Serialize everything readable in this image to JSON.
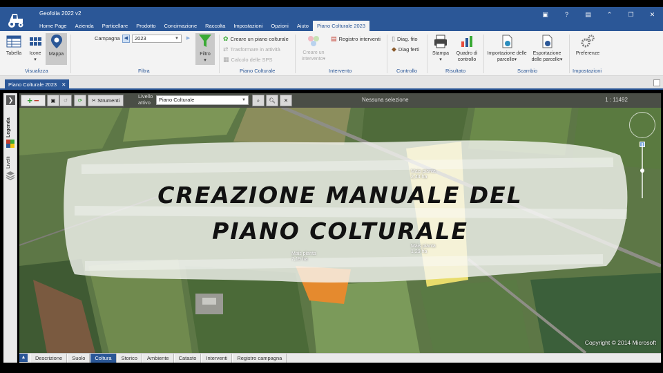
{
  "app": {
    "title": "Geofolia 2022 v2",
    "menu": [
      "Home Page",
      "Azienda",
      "Particellare",
      "Prodotto",
      "Concimazione",
      "Raccolta",
      "Impostazioni",
      "Opzioni",
      "Aiuto",
      "Piano Colturale 2023"
    ],
    "active_menu": "Piano Colturale 2023",
    "window_controls": [
      "▣",
      "?",
      "▤",
      "⌃",
      "❐",
      "✕"
    ]
  },
  "ribbon": {
    "visualizza": {
      "label": "Visualizza",
      "tabella": "Tabella",
      "icone": "Icone",
      "mappa": "Mappa"
    },
    "filtra": {
      "label": "Filtra",
      "campagna_label": "Campagna",
      "campagna_value": "2023",
      "filtro": "Filtro"
    },
    "piano": {
      "label": "Piano Colturale",
      "creare": "Creare un piano colturale",
      "trasformare": "Trasformare in attività",
      "calcolo": "Calcolo delle SPS"
    },
    "intervento": {
      "label": "Intervento",
      "creare": "Creare un intervento",
      "registro": "Registro interventi"
    },
    "controllo": {
      "label": "Controllo",
      "diag_fito": "Diag. fito",
      "diag_ferti": "Diag ferti"
    },
    "risultato": {
      "label": "Risultato",
      "stampa": "Stampa",
      "quadro": "Quadro di controllo"
    },
    "scambio": {
      "label": "Scambio",
      "importazione": "Importazione delle parcelle",
      "esportazione": "Esportazione delle parcelle"
    },
    "impostazioni": {
      "label": "Impostazioni",
      "preferenze": "Preferenze"
    }
  },
  "doc_tab": {
    "label": "Piano Colturale 2023",
    "close": "✕"
  },
  "left_rail": {
    "legenda": "Legenda",
    "livelli": "Livelli"
  },
  "map": {
    "toolbar": {
      "strumenti": "Strumenti",
      "livello_label_1": "Livello",
      "livello_label_2": "attivo",
      "livello_value": "Piano Colturale",
      "selection": "Nessuna selezione",
      "scale": "1 : 11492"
    },
    "headline_line1": "CREAZIONE MANUALE DEL",
    "headline_line2": "PIANO COLTURALE",
    "parcels": [
      {
        "name": "Mais pianta",
        "area": "2,44 ha"
      },
      {
        "name": "Mais pianta",
        "area": "1,29 ha"
      },
      {
        "name": "Mais pianta",
        "area": "7,19 ha"
      }
    ],
    "copyright": "Copyright © 2014 Microsoft"
  },
  "bottom_tabs": [
    "Descrizione",
    "Suolo",
    "Coltura",
    "Storico",
    "Ambiente",
    "Catasto",
    "Interventi",
    "Registro campagna"
  ],
  "bottom_active": "Coltura",
  "colors": {
    "brand": "#2b5797",
    "filtro_green": "#3aaa35"
  }
}
